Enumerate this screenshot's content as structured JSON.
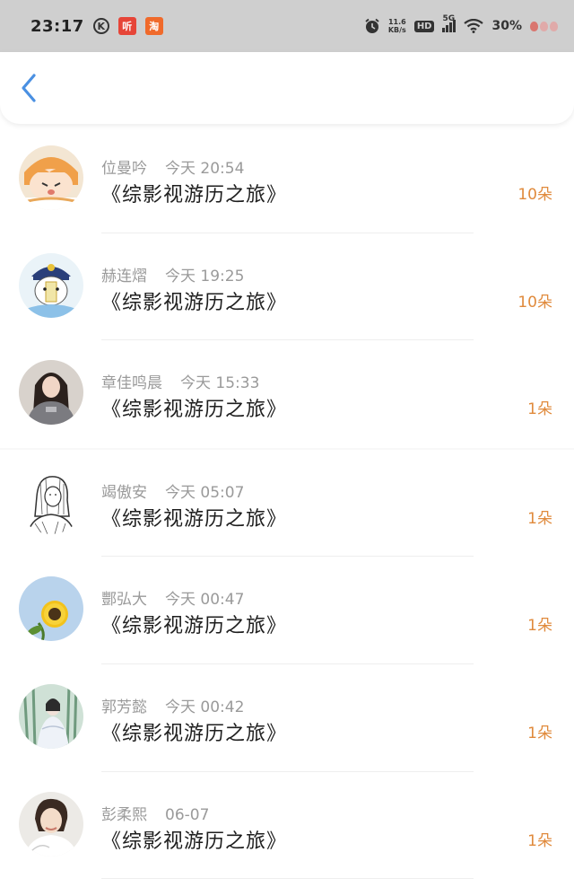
{
  "status_bar": {
    "time": "23:17",
    "k_icon": "K",
    "app1_label": "听",
    "app2_label": "淘",
    "net_speed_value": "11.6",
    "net_speed_unit": "KB/s",
    "hd_label": "HD",
    "signal_label": "5G",
    "battery": "30%"
  },
  "header": {
    "back_icon": "chevron-left-icon",
    "accent_color": "#4a90e2"
  },
  "colors": {
    "count": "#e08a3c",
    "meta": "#9a9a9a"
  },
  "items": [
    {
      "name": "位曼吟",
      "time": "今天 20:54",
      "title": "《综影视游历之旅》",
      "count": "10朵"
    },
    {
      "name": "赫连熠",
      "time": "今天 19:25",
      "title": "《综影视游历之旅》",
      "count": "10朵"
    },
    {
      "name": "章佳鸣晨",
      "time": "今天 15:33",
      "title": "《综影视游历之旅》",
      "count": "1朵"
    },
    {
      "name": "竭傲安",
      "time": "今天 05:07",
      "title": "《综影视游历之旅》",
      "count": "1朵"
    },
    {
      "name": "酆弘大",
      "time": "今天 00:47",
      "title": "《综影视游历之旅》",
      "count": "1朵"
    },
    {
      "name": "郭芳懿",
      "time": "今天 00:42",
      "title": "《综影视游历之旅》",
      "count": "1朵"
    },
    {
      "name": "彭柔熙",
      "time": "06-07",
      "title": "《综影视游历之旅》",
      "count": "1朵"
    }
  ]
}
